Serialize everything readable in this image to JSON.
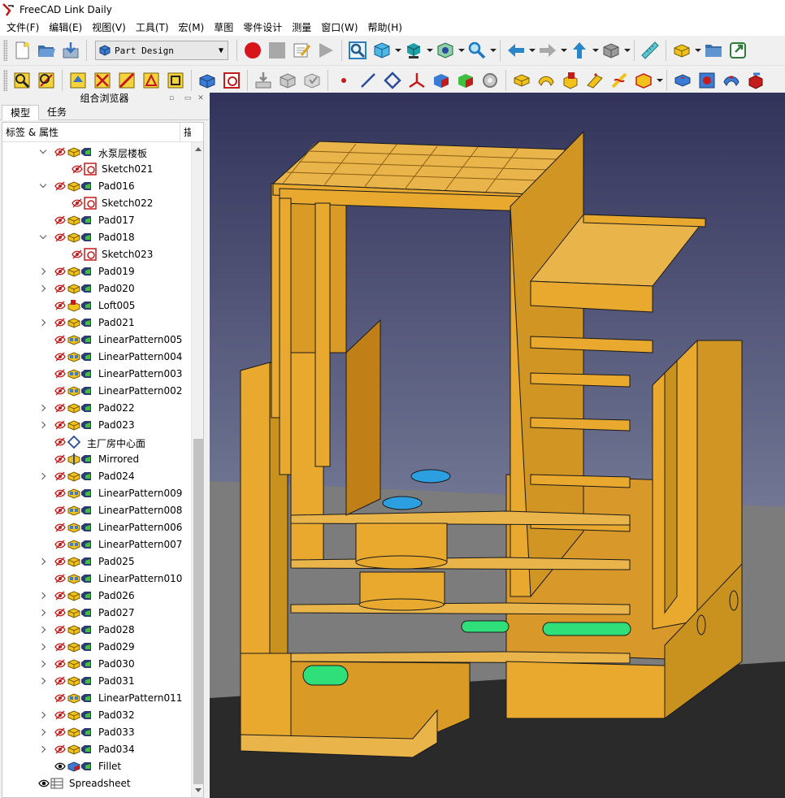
{
  "window": {
    "title": "FreeCAD Link Daily"
  },
  "menu": [
    "文件(F)",
    "编辑(E)",
    "视图(V)",
    "工具(T)",
    "宏(M)",
    "草图",
    "零件设计",
    "测量",
    "窗口(W)",
    "帮助(H)"
  ],
  "toolbar": {
    "workbench_selected": "Part Design"
  },
  "combo_view": {
    "title": "组合浏览器",
    "tabs": [
      "模型",
      "任务"
    ],
    "tree_header": "标签 & 属性",
    "tree_header_2": "描",
    "items": [
      {
        "label": "水泵层楼板",
        "expander": "down",
        "level": 1,
        "icon": "pad"
      },
      {
        "label": "Sketch021",
        "expander": "",
        "level": 2,
        "icon": "sketch"
      },
      {
        "label": "Pad016",
        "expander": "down",
        "level": 1,
        "icon": "pad"
      },
      {
        "label": "Sketch022",
        "expander": "",
        "level": 2,
        "icon": "sketch"
      },
      {
        "label": "Pad017",
        "expander": "",
        "level": 1,
        "icon": "pad"
      },
      {
        "label": "Pad018",
        "expander": "down",
        "level": 1,
        "icon": "pad"
      },
      {
        "label": "Sketch023",
        "expander": "",
        "level": 2,
        "icon": "sketch"
      },
      {
        "label": "Pad019",
        "expander": "right",
        "level": 1,
        "icon": "pad"
      },
      {
        "label": "Pad020",
        "expander": "right",
        "level": 1,
        "icon": "pad"
      },
      {
        "label": "Loft005",
        "expander": "",
        "level": 1,
        "icon": "loft"
      },
      {
        "label": "Pad021",
        "expander": "right",
        "level": 1,
        "icon": "pad"
      },
      {
        "label": "LinearPattern005",
        "expander": "",
        "level": 1,
        "icon": "pattern"
      },
      {
        "label": "LinearPattern004",
        "expander": "",
        "level": 1,
        "icon": "pattern"
      },
      {
        "label": "LinearPattern003",
        "expander": "",
        "level": 1,
        "icon": "pattern"
      },
      {
        "label": "LinearPattern002",
        "expander": "",
        "level": 1,
        "icon": "pattern"
      },
      {
        "label": "Pad022",
        "expander": "right",
        "level": 1,
        "icon": "pad"
      },
      {
        "label": "Pad023",
        "expander": "right",
        "level": 1,
        "icon": "pad"
      },
      {
        "label": "主厂房中心面",
        "expander": "",
        "level": 1,
        "icon": "plane"
      },
      {
        "label": "Mirrored",
        "expander": "",
        "level": 1,
        "icon": "mirrored"
      },
      {
        "label": "Pad024",
        "expander": "right",
        "level": 1,
        "icon": "pad"
      },
      {
        "label": "LinearPattern009",
        "expander": "",
        "level": 1,
        "icon": "pattern"
      },
      {
        "label": "LinearPattern008",
        "expander": "",
        "level": 1,
        "icon": "pattern"
      },
      {
        "label": "LinearPattern006",
        "expander": "",
        "level": 1,
        "icon": "pattern"
      },
      {
        "label": "LinearPattern007",
        "expander": "",
        "level": 1,
        "icon": "pattern"
      },
      {
        "label": "Pad025",
        "expander": "right",
        "level": 1,
        "icon": "pad"
      },
      {
        "label": "LinearPattern010",
        "expander": "",
        "level": 1,
        "icon": "pattern"
      },
      {
        "label": "Pad026",
        "expander": "right",
        "level": 1,
        "icon": "pad"
      },
      {
        "label": "Pad027",
        "expander": "right",
        "level": 1,
        "icon": "pad"
      },
      {
        "label": "Pad028",
        "expander": "right",
        "level": 1,
        "icon": "pad"
      },
      {
        "label": "Pad029",
        "expander": "right",
        "level": 1,
        "icon": "pad"
      },
      {
        "label": "Pad030",
        "expander": "right",
        "level": 1,
        "icon": "pad"
      },
      {
        "label": "Pad031",
        "expander": "right",
        "level": 1,
        "icon": "pad"
      },
      {
        "label": "LinearPattern011",
        "expander": "",
        "level": 1,
        "icon": "pattern"
      },
      {
        "label": "Pad032",
        "expander": "right",
        "level": 1,
        "icon": "pad"
      },
      {
        "label": "Pad033",
        "expander": "right",
        "level": 1,
        "icon": "pad"
      },
      {
        "label": "Pad034",
        "expander": "right",
        "level": 1,
        "icon": "pad"
      },
      {
        "label": "Fillet",
        "expander": "",
        "level": 1,
        "icon": "fillet"
      },
      {
        "label": "Spreadsheet",
        "expander": "",
        "level": 0,
        "icon": "spreadsheet"
      }
    ]
  },
  "colors": {
    "model_fill": "#E8A92E",
    "model_edge": "#1a1a1a",
    "bg_top": "#32335a",
    "bg_bottom": "#9ea6bd",
    "ground": "#7c7c7c",
    "pipe": "#2fe07a",
    "pump_top": "#2c9fe0"
  }
}
